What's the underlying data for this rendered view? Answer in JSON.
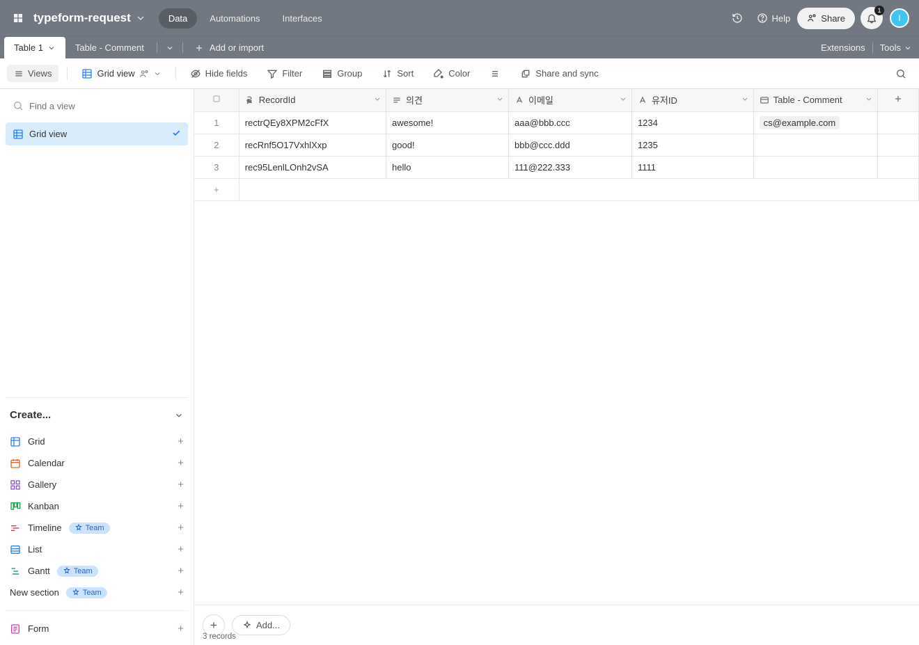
{
  "header": {
    "base_name": "typeform-request",
    "nav": {
      "data": "Data",
      "automations": "Automations",
      "interfaces": "Interfaces"
    },
    "help": "Help",
    "share": "Share",
    "bell_count": "1",
    "avatar_initial": "I"
  },
  "tabs": {
    "table1": "Table 1",
    "table_comment": "Table - Comment",
    "add_or_import": "Add or import",
    "extensions": "Extensions",
    "tools": "Tools"
  },
  "toolbar": {
    "views": "Views",
    "grid_view": "Grid view",
    "hide_fields": "Hide fields",
    "filter": "Filter",
    "group": "Group",
    "sort": "Sort",
    "color": "Color",
    "share_sync": "Share and sync"
  },
  "sidebar": {
    "find_placeholder": "Find a view",
    "view_grid": "Grid view",
    "create_label": "Create...",
    "items": {
      "grid": "Grid",
      "calendar": "Calendar",
      "gallery": "Gallery",
      "kanban": "Kanban",
      "timeline": "Timeline",
      "list": "List",
      "gantt": "Gantt",
      "new_section": "New section",
      "form": "Form"
    },
    "team": "Team"
  },
  "columns": {
    "recordid": "RecordId",
    "opinion": "의견",
    "email": "이메일",
    "userid": "유저ID",
    "table_comment": "Table - Comment"
  },
  "rows": [
    {
      "n": "1",
      "recordid": "rectrQEy8XPM2cFfX",
      "opinion": "awesome!",
      "email": "aaa@bbb.ccc",
      "userid": "1234",
      "linked": "cs@example.com"
    },
    {
      "n": "2",
      "recordid": "recRnf5O17VxhlXxp",
      "opinion": "good!",
      "email": "bbb@ccc.ddd",
      "userid": "1235",
      "linked": ""
    },
    {
      "n": "3",
      "recordid": "rec95LenlLOnh2vSA",
      "opinion": "hello",
      "email": "111@222.333",
      "userid": "1111",
      "linked": ""
    }
  ],
  "footer": {
    "add": "Add...",
    "record_count": "3 records"
  }
}
